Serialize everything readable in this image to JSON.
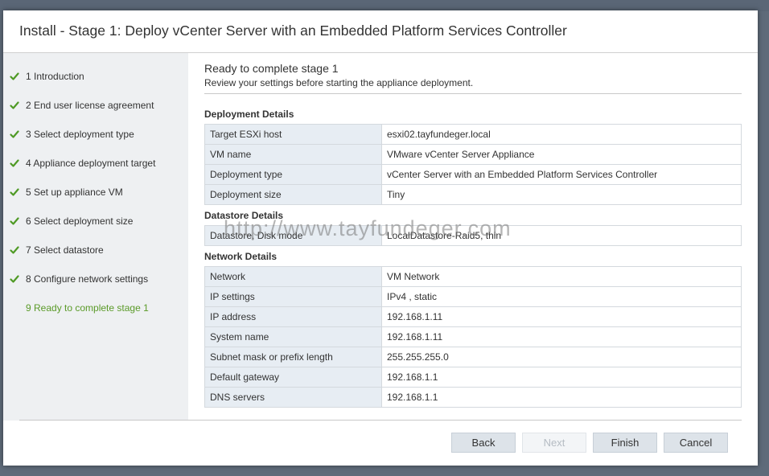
{
  "dialog": {
    "title": "Install - Stage 1: Deploy vCenter Server with an Embedded Platform Services Controller"
  },
  "sidebar": {
    "steps": [
      {
        "label": "1 Introduction",
        "status": "complete"
      },
      {
        "label": "2 End user license agreement",
        "status": "complete"
      },
      {
        "label": "3 Select deployment type",
        "status": "complete"
      },
      {
        "label": "4 Appliance deployment target",
        "status": "complete"
      },
      {
        "label": "5 Set up appliance VM",
        "status": "complete"
      },
      {
        "label": "6 Select deployment size",
        "status": "complete"
      },
      {
        "label": "7 Select datastore",
        "status": "complete"
      },
      {
        "label": "8 Configure network settings",
        "status": "complete"
      },
      {
        "label": "9 Ready to complete stage 1",
        "status": "current"
      }
    ],
    "check_icon": "check-icon",
    "check_color": "#4f9a25",
    "current_color": "#5a9a28"
  },
  "content": {
    "title": "Ready to complete stage 1",
    "subtitle": "Review your settings before starting the appliance deployment.",
    "sections": [
      {
        "heading": "Deployment Details",
        "rows": [
          {
            "label": "Target ESXi host",
            "value": "esxi02.tayfundeger.local"
          },
          {
            "label": "VM name",
            "value": "VMware vCenter Server Appliance"
          },
          {
            "label": "Deployment type",
            "value": "vCenter Server with an Embedded Platform Services Controller"
          },
          {
            "label": "Deployment size",
            "value": "Tiny"
          }
        ]
      },
      {
        "heading": "Datastore Details",
        "rows": [
          {
            "label": "Datastore, Disk mode",
            "value": "LocalDatastore-Raid5, thin"
          }
        ]
      },
      {
        "heading": "Network Details",
        "rows": [
          {
            "label": "Network",
            "value": "VM Network"
          },
          {
            "label": "IP settings",
            "value": "IPv4 , static"
          },
          {
            "label": "IP address",
            "value": "192.168.1.11"
          },
          {
            "label": "System name",
            "value": "192.168.1.11"
          },
          {
            "label": "Subnet mask or prefix length",
            "value": "255.255.255.0"
          },
          {
            "label": "Default gateway",
            "value": "192.168.1.1"
          },
          {
            "label": "DNS servers",
            "value": "192.168.1.1"
          }
        ]
      }
    ]
  },
  "watermark": "http://www.tayfundeger.com",
  "footer": {
    "back_label": "Back",
    "next_label": "Next",
    "finish_label": "Finish",
    "cancel_label": "Cancel",
    "next_disabled": true
  }
}
